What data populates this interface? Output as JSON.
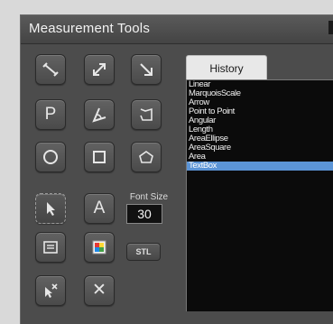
{
  "window": {
    "title": "Measurement Tools"
  },
  "tools": {
    "font_size_label": "Font Size",
    "font_size_value": "30",
    "stl_label": "STL",
    "text_tool_label": "A",
    "point_tool_label": "P",
    "close_label": "✕"
  },
  "history": {
    "tab_label": "History",
    "items": [
      "Linear",
      "MarquoisScale",
      "Arrow",
      "Point to Point",
      "Angular",
      "Length",
      "AreaEllipse",
      "AreaSquare",
      "Area",
      "TextBox"
    ],
    "selected_index": 9
  }
}
